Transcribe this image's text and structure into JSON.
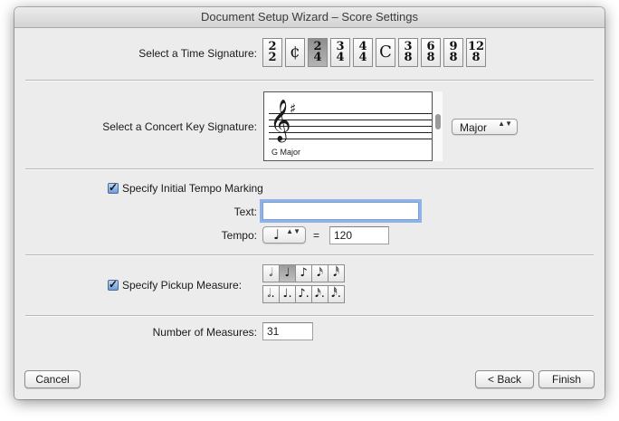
{
  "window": {
    "title": "Document Setup Wizard – Score Settings"
  },
  "time_signature": {
    "label": "Select a Time Signature:",
    "options": [
      {
        "top": "2",
        "bottom": "2"
      },
      {
        "symbol": "¢"
      },
      {
        "top": "2",
        "bottom": "4",
        "selected": true
      },
      {
        "top": "3",
        "bottom": "4"
      },
      {
        "top": "4",
        "bottom": "4"
      },
      {
        "symbol": "C"
      },
      {
        "top": "3",
        "bottom": "8"
      },
      {
        "top": "6",
        "bottom": "8"
      },
      {
        "top": "9",
        "bottom": "8"
      },
      {
        "top": "12",
        "bottom": "8"
      }
    ]
  },
  "key_signature": {
    "label": "Select a Concert Key Signature:",
    "key_name": "G Major",
    "clef_glyph": "𝄞",
    "accidental_glyph": "♯",
    "mode_value": "Major"
  },
  "tempo": {
    "checkbox_label": "Specify Initial Tempo Marking",
    "checked": true,
    "text_label": "Text:",
    "text_value": "",
    "tempo_label": "Tempo:",
    "note_glyph": "♩",
    "equals": "=",
    "bpm_value": "120"
  },
  "pickup": {
    "checkbox_label": "Specify Pickup Measure:",
    "checked": true,
    "row1": [
      "𝅗𝅥",
      "♩",
      "♪",
      "𝅘𝅥𝅯",
      "𝅘𝅥𝅰"
    ],
    "row2": [
      "𝅗𝅥.",
      "♩.",
      "♪.",
      "𝅘𝅥𝅯.",
      "𝅘𝅥𝅰."
    ],
    "selected_index": 1
  },
  "measures": {
    "label": "Number of Measures:",
    "value": "31"
  },
  "buttons": {
    "cancel": "Cancel",
    "back": "< Back",
    "finish": "Finish"
  },
  "checkmark_glyph": "✓",
  "popup_arrows": "▲▼"
}
